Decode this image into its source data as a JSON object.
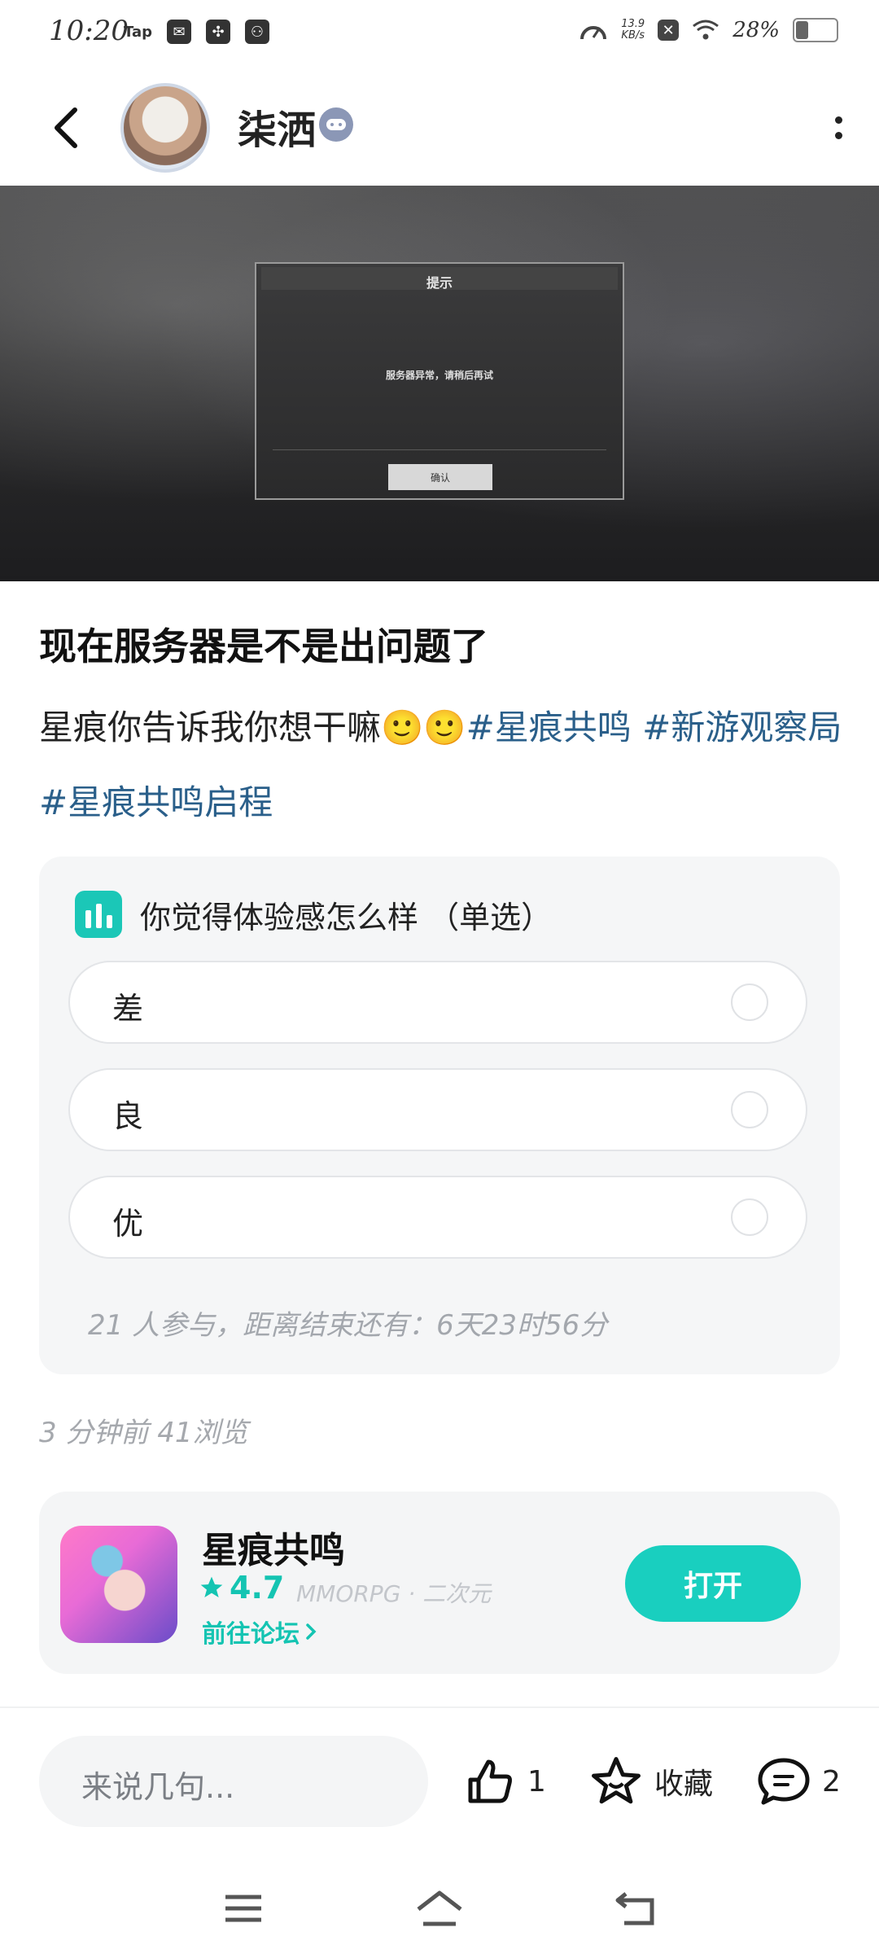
{
  "status_bar": {
    "time": "10:20",
    "tap_label": "Tap",
    "net_speed_value": "13.9",
    "net_speed_unit": "KB/s",
    "battery_pct": "28%",
    "battery_level": 0.28
  },
  "header": {
    "username": "柒洒"
  },
  "hero_dialog": {
    "title": "提示",
    "message": "服务器异常，请稍后再试",
    "button": "确认"
  },
  "post": {
    "title": "现在服务器是不是出问题了",
    "body_text": "星痕你告诉我你想干嘛🙂🙂",
    "tags": [
      "#星痕共鸣",
      "#新游观察局",
      "#星痕共鸣启程"
    ]
  },
  "poll": {
    "title": "你觉得体验感怎么样 （单选）",
    "options": [
      "差",
      "良",
      "优"
    ],
    "status": "21 人参与，距离结束还有：6天23时56分"
  },
  "meta": "3 分钟前  41浏览",
  "game_card": {
    "name": "星痕共鸣",
    "rating": "4.7",
    "genre": "MMORPG · 二次元",
    "forum_link": "前往论坛",
    "open_button": "打开"
  },
  "bottom_bar": {
    "comment_placeholder": "来说几句...",
    "like_count": "1",
    "favorite_label": "收藏",
    "comment_count": "2"
  },
  "colors": {
    "accent": "#19cfbf",
    "tag": "#2a5f8a"
  }
}
